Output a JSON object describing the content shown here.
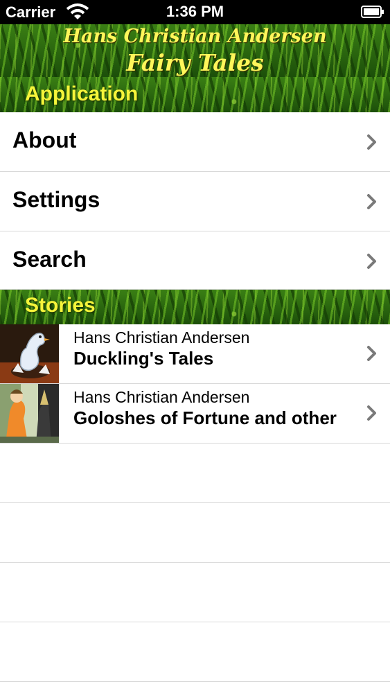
{
  "status_bar": {
    "carrier": "Carrier",
    "time": "1:36 PM"
  },
  "banner": {
    "line1": "Hans Christian Andersen",
    "line2": "Fairy Tales"
  },
  "sections": {
    "application": {
      "title": "Application",
      "items": [
        {
          "label": "About"
        },
        {
          "label": "Settings"
        },
        {
          "label": "Search"
        }
      ]
    },
    "stories": {
      "title": "Stories",
      "items": [
        {
          "author": "Hans Christian Andersen",
          "title": "Duckling's Tales"
        },
        {
          "author": "Hans Christian Andersen",
          "title": "Goloshes of Fortune and other"
        }
      ]
    }
  }
}
